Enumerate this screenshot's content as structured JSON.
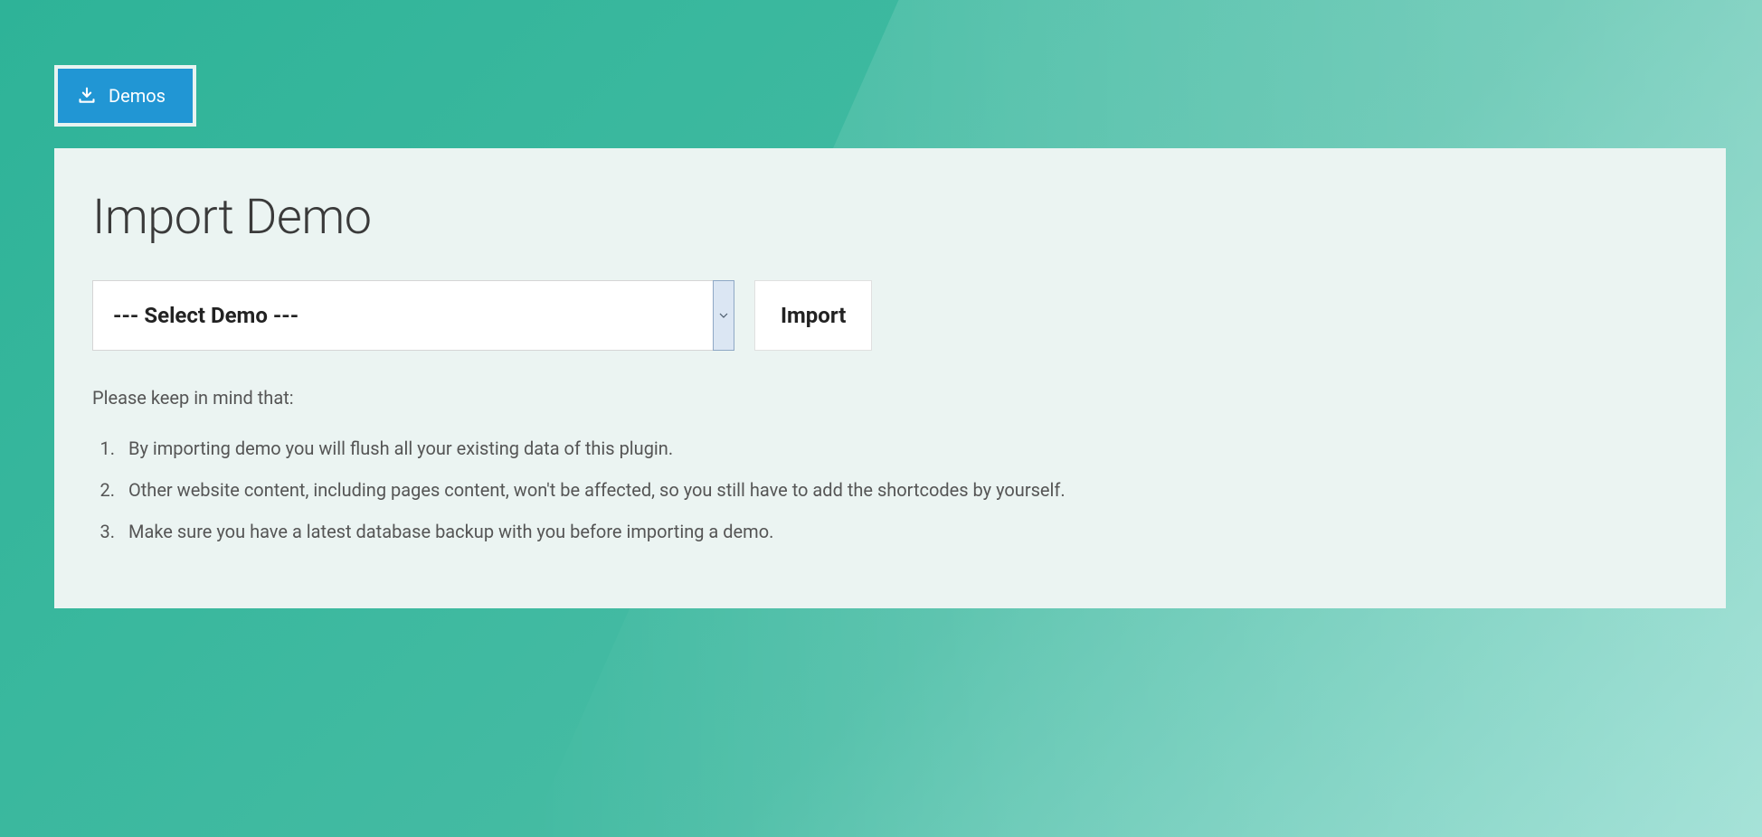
{
  "tab": {
    "label": "Demos"
  },
  "page": {
    "title": "Import Demo"
  },
  "select": {
    "placeholder": "--- Select Demo ---"
  },
  "actions": {
    "import_label": "Import"
  },
  "notice": {
    "intro": "Please keep in mind that:",
    "items": [
      "By importing demo you will flush all your existing data of this plugin.",
      "Other website content, including pages content, won't be affected, so you still have to add the shortcodes by yourself.",
      "Make sure you have a latest database backup with you before importing a demo."
    ]
  }
}
